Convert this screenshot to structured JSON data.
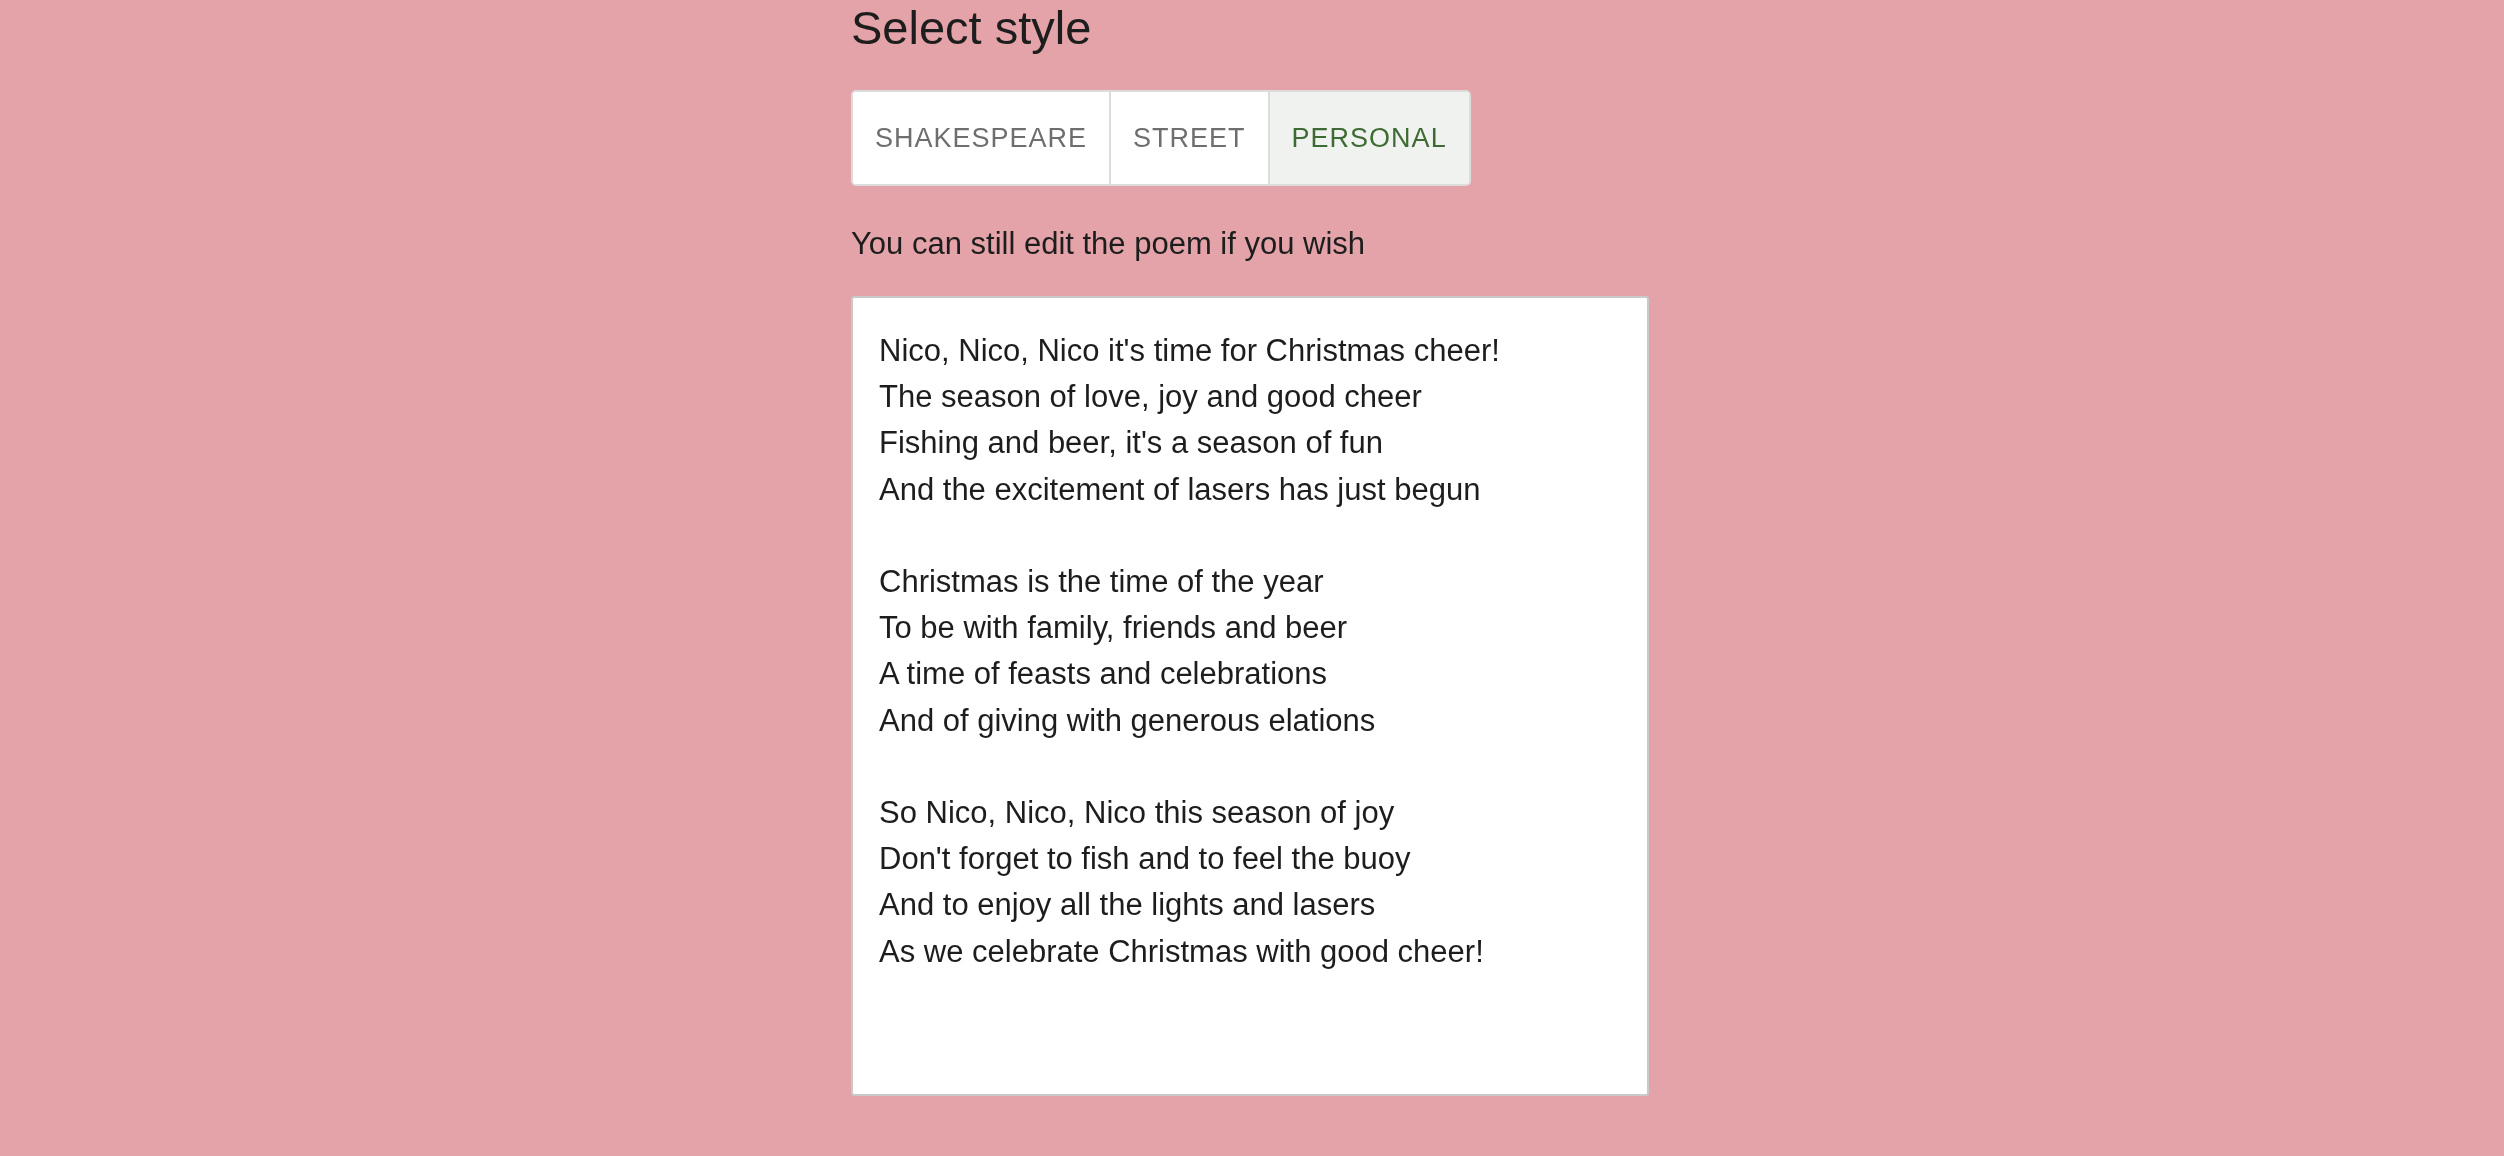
{
  "heading": "Select style",
  "tabs": [
    {
      "label": "SHAKESPEARE",
      "selected": false
    },
    {
      "label": "STREET",
      "selected": false
    },
    {
      "label": "PERSONAL",
      "selected": true
    }
  ],
  "hint": "You can still edit the poem if you wish",
  "poem": {
    "value": "Nico, Nico, Nico it's time for Christmas cheer!\nThe season of love, joy and good cheer\nFishing and beer, it's a season of fun\nAnd the excitement of lasers has just begun\n\nChristmas is the time of the year\nTo be with family, friends and beer\nA time of feasts and celebrations\nAnd of giving with generous elations\n\nSo Nico, Nico, Nico this season of joy\nDon't forget to fish and to feel the buoy\nAnd to enjoy all the lights and lasers\nAs we celebrate Christmas with good cheer!"
  }
}
